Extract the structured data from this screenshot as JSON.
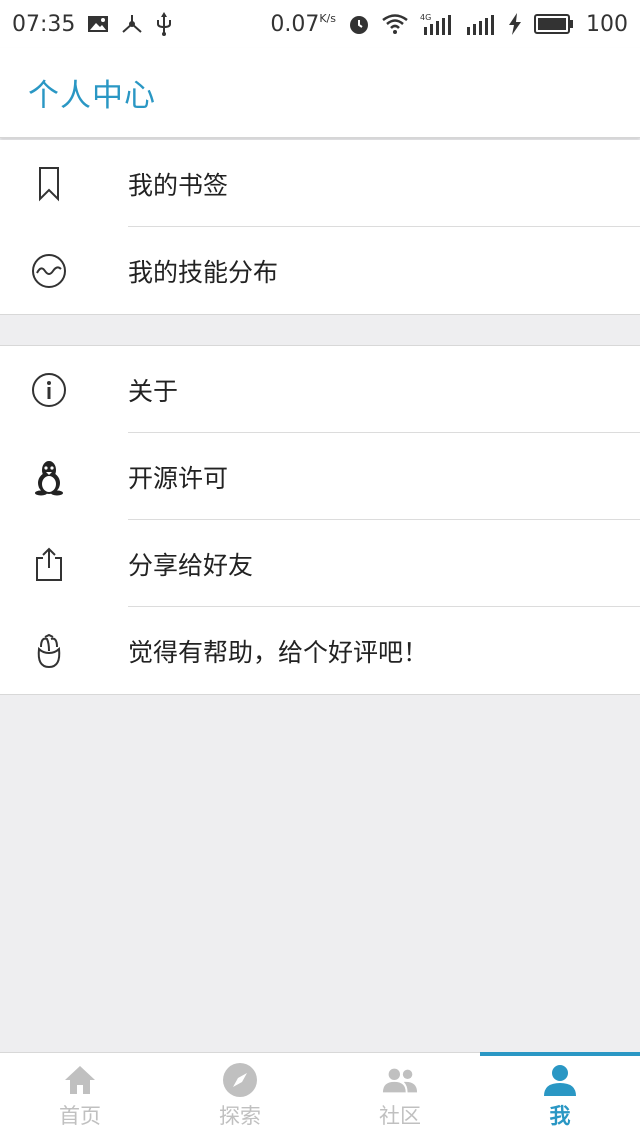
{
  "status_bar": {
    "time": "07:35",
    "net_speed": "0.07",
    "net_unit": "K/s",
    "network": "4G",
    "battery": "100",
    "icons": [
      "image-icon",
      "usb-hub-icon",
      "usb-icon",
      "alarm-icon",
      "wifi-icon",
      "signal-icon",
      "charging-icon",
      "battery-icon"
    ]
  },
  "header": {
    "title": "个人中心"
  },
  "menu": {
    "group1": [
      {
        "label": "我的书签",
        "icon": "bookmark-icon"
      },
      {
        "label": "我的技能分布",
        "icon": "wave-circle-icon"
      }
    ],
    "group2": [
      {
        "label": "关于",
        "icon": "info-icon"
      },
      {
        "label": "开源许可",
        "icon": "linux-penguin-icon"
      },
      {
        "label": "分享给好友",
        "icon": "share-icon"
      },
      {
        "label": "觉得有帮助，给个好评吧！",
        "icon": "flower-icon"
      }
    ]
  },
  "tabs": [
    {
      "label": "首页",
      "icon": "home-icon",
      "active": false
    },
    {
      "label": "探索",
      "icon": "compass-icon",
      "active": false
    },
    {
      "label": "社区",
      "icon": "community-icon",
      "active": false
    },
    {
      "label": "我",
      "icon": "person-icon",
      "active": true
    }
  ],
  "colors": {
    "accent": "#2a97c4",
    "inactive_tab": "#c0c0c0",
    "background": "#eeeef0"
  }
}
